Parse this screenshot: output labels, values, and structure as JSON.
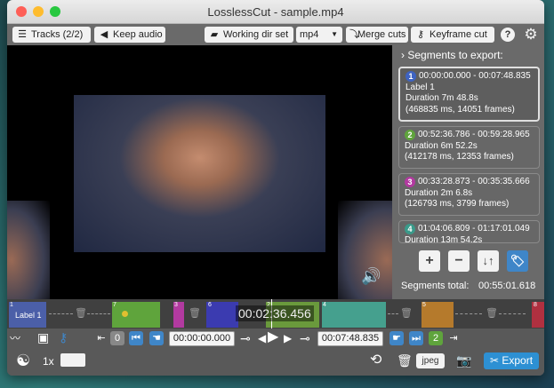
{
  "window": {
    "title": "LosslessCut - sample.mp4"
  },
  "toolbar": {
    "tracks_label": "Tracks (2/2)",
    "keep_audio_label": "Keep audio",
    "working_dir_label": "Working dir set",
    "format_value": "mp4",
    "merge_cuts_label": "Merge cuts",
    "keyframe_cut_label": "Keyframe cut",
    "help_label": "?"
  },
  "segments_panel": {
    "title": "Segments to export:",
    "segments": [
      {
        "number": "1",
        "range": "00:00:00.000 - 00:07:48.835",
        "label": "Label 1",
        "duration": "Duration 7m 48.8s",
        "details": "(468835 ms, 14051 frames)",
        "color": "#3e63c2"
      },
      {
        "number": "2",
        "range": "00:52:36.786 - 00:59:28.965",
        "duration": "Duration 6m 52.2s",
        "details": "(412178 ms, 12353 frames)",
        "color": "#5fa43c"
      },
      {
        "number": "3",
        "range": "00:33:28.873 - 00:35:35.666",
        "duration": "Duration 2m 6.8s",
        "details": "(126793 ms, 3799 frames)",
        "color": "#b23aa0"
      },
      {
        "number": "4",
        "range": "01:04:06.809 - 01:17:01.049",
        "duration": "Duration 13m 54.2s",
        "color": "#3a9a8a"
      }
    ],
    "total_label": "Segments total:",
    "total_value": "00:55:01.618"
  },
  "timeline": {
    "timecode": "00:02:36.456",
    "segment_labels": [
      "1",
      "Label 1",
      "7",
      "3",
      "6",
      "2",
      "4",
      "5",
      "8"
    ],
    "colors": {
      "seg1": "#4b5fa8",
      "seg7": "#5fa43c",
      "seg3": "#b23aa0",
      "seg6": "#3b3bb0",
      "seg2": "#6a9a3c",
      "seg4": "#45a08e",
      "seg5": "#b57a2c",
      "seg8": "#b03040"
    }
  },
  "controls": {
    "start_time": "00:00:00.000",
    "end_time": "00:07:48.835",
    "left_segment_number": "0",
    "right_segment_number": "2",
    "speed_label": "1x",
    "jpeg_label": "jpeg",
    "export_label": "Export"
  },
  "icons": [
    "menu-icon",
    "speaker-icon",
    "folder-icon",
    "merge-icon",
    "key-icon",
    "help-icon",
    "gear-icon",
    "plus-icon",
    "minus-icon",
    "sort-icon",
    "tag-icon",
    "trash-icon",
    "play-icon",
    "camera-icon",
    "scissors-icon"
  ]
}
